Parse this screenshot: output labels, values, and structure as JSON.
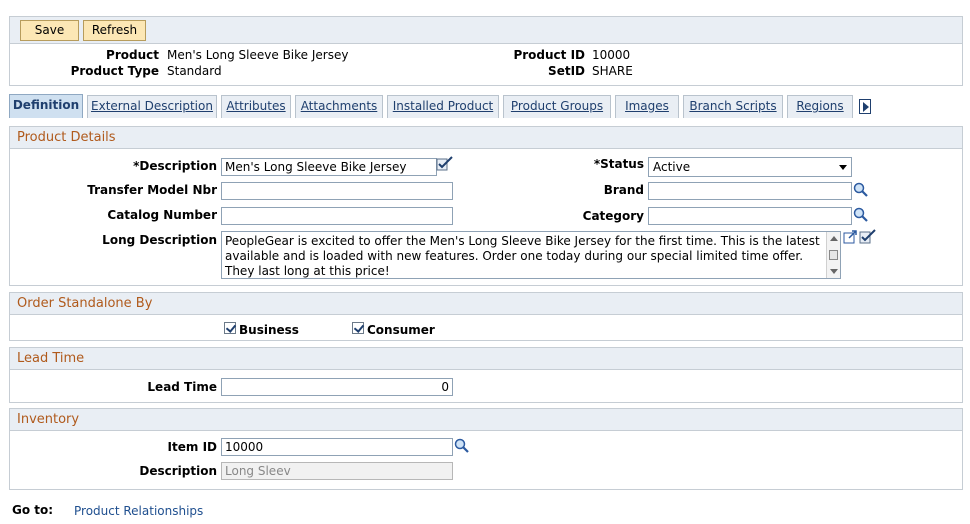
{
  "toolbar": {
    "save": "Save",
    "refresh": "Refresh"
  },
  "header": {
    "product_label": "Product",
    "product_value": "Men's Long Sleeve Bike Jersey",
    "type_label": "Product Type",
    "type_value": "Standard",
    "id_label": "Product ID",
    "id_value": "10000",
    "setid_label": "SetID",
    "setid_value": "SHARE"
  },
  "tabs": [
    {
      "label": "Definition"
    },
    {
      "label": "External Description"
    },
    {
      "label": "Attributes"
    },
    {
      "label": "Attachments"
    },
    {
      "label": "Installed Product"
    },
    {
      "label": "Product Groups"
    },
    {
      "label": "Images"
    },
    {
      "label": "Branch Scripts"
    },
    {
      "label": "Regions"
    }
  ],
  "details": {
    "title": "Product Details",
    "description_label": "*Description",
    "description_value": "Men's Long Sleeve Bike Jersey",
    "status_label": "*Status",
    "status_value": "Active",
    "transfer_label": "Transfer Model Nbr",
    "transfer_value": "",
    "brand_label": "Brand",
    "brand_value": "",
    "catalog_label": "Catalog Number",
    "catalog_value": "",
    "category_label": "Category",
    "category_value": "",
    "long_label": "Long Description",
    "long_value": "PeopleGear is excited to offer the Men's Long Sleeve Bike Jersey for the first time.  This is the latest available and is loaded with new features. Order one today during our special limited time offer. They last long at this price!"
  },
  "standalone": {
    "title": "Order Standalone By",
    "business": "Business",
    "consumer": "Consumer",
    "business_checked": true,
    "consumer_checked": true
  },
  "lead": {
    "title": "Lead Time",
    "label": "Lead Time",
    "value": "0"
  },
  "inventory": {
    "title": "Inventory",
    "item_label": "Item ID",
    "item_value": "10000",
    "desc_label": "Description",
    "desc_value": "Long Sleev"
  },
  "goto": {
    "label": "Go to:",
    "link": "Product Relationships"
  },
  "colors": {
    "section_title": "#b05a1c",
    "link": "#1f4f8f",
    "button": "#fce7b5"
  }
}
